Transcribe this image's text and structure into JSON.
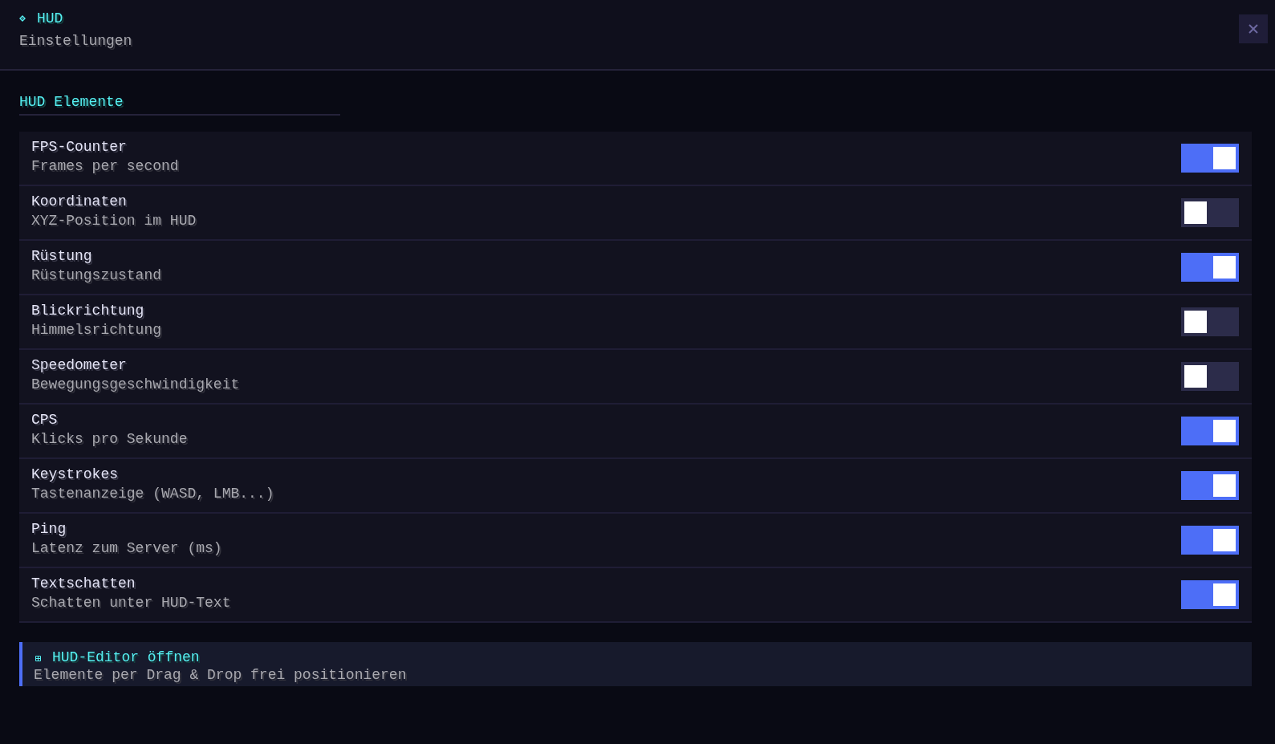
{
  "header": {
    "title": "HUD",
    "subtitle": "Einstellungen"
  },
  "section": {
    "title": "HUD Elemente"
  },
  "elements": [
    {
      "name": "FPS-Counter",
      "description": "Frames per second",
      "on": true
    },
    {
      "name": "Koordinaten",
      "description": "XYZ-Position im HUD",
      "on": false
    },
    {
      "name": "Rüstung",
      "description": "Rüstungszustand",
      "on": true
    },
    {
      "name": "Blickrichtung",
      "description": "Himmelsrichtung",
      "on": false
    },
    {
      "name": "Speedometer",
      "description": "Bewegungsgeschwindigkeit",
      "on": false
    },
    {
      "name": "CPS",
      "description": "Klicks pro Sekunde",
      "on": true
    },
    {
      "name": "Keystrokes",
      "description": "Tastenanzeige (WASD, LMB...)",
      "on": true
    },
    {
      "name": "Ping",
      "description": "Latenz zum Server (ms)",
      "on": true
    },
    {
      "name": "Textschatten",
      "description": "Schatten unter HUD-Text",
      "on": true
    }
  ],
  "editor": {
    "title": "HUD-Editor öffnen",
    "description": "Elemente per Drag & Drop frei positionieren"
  }
}
